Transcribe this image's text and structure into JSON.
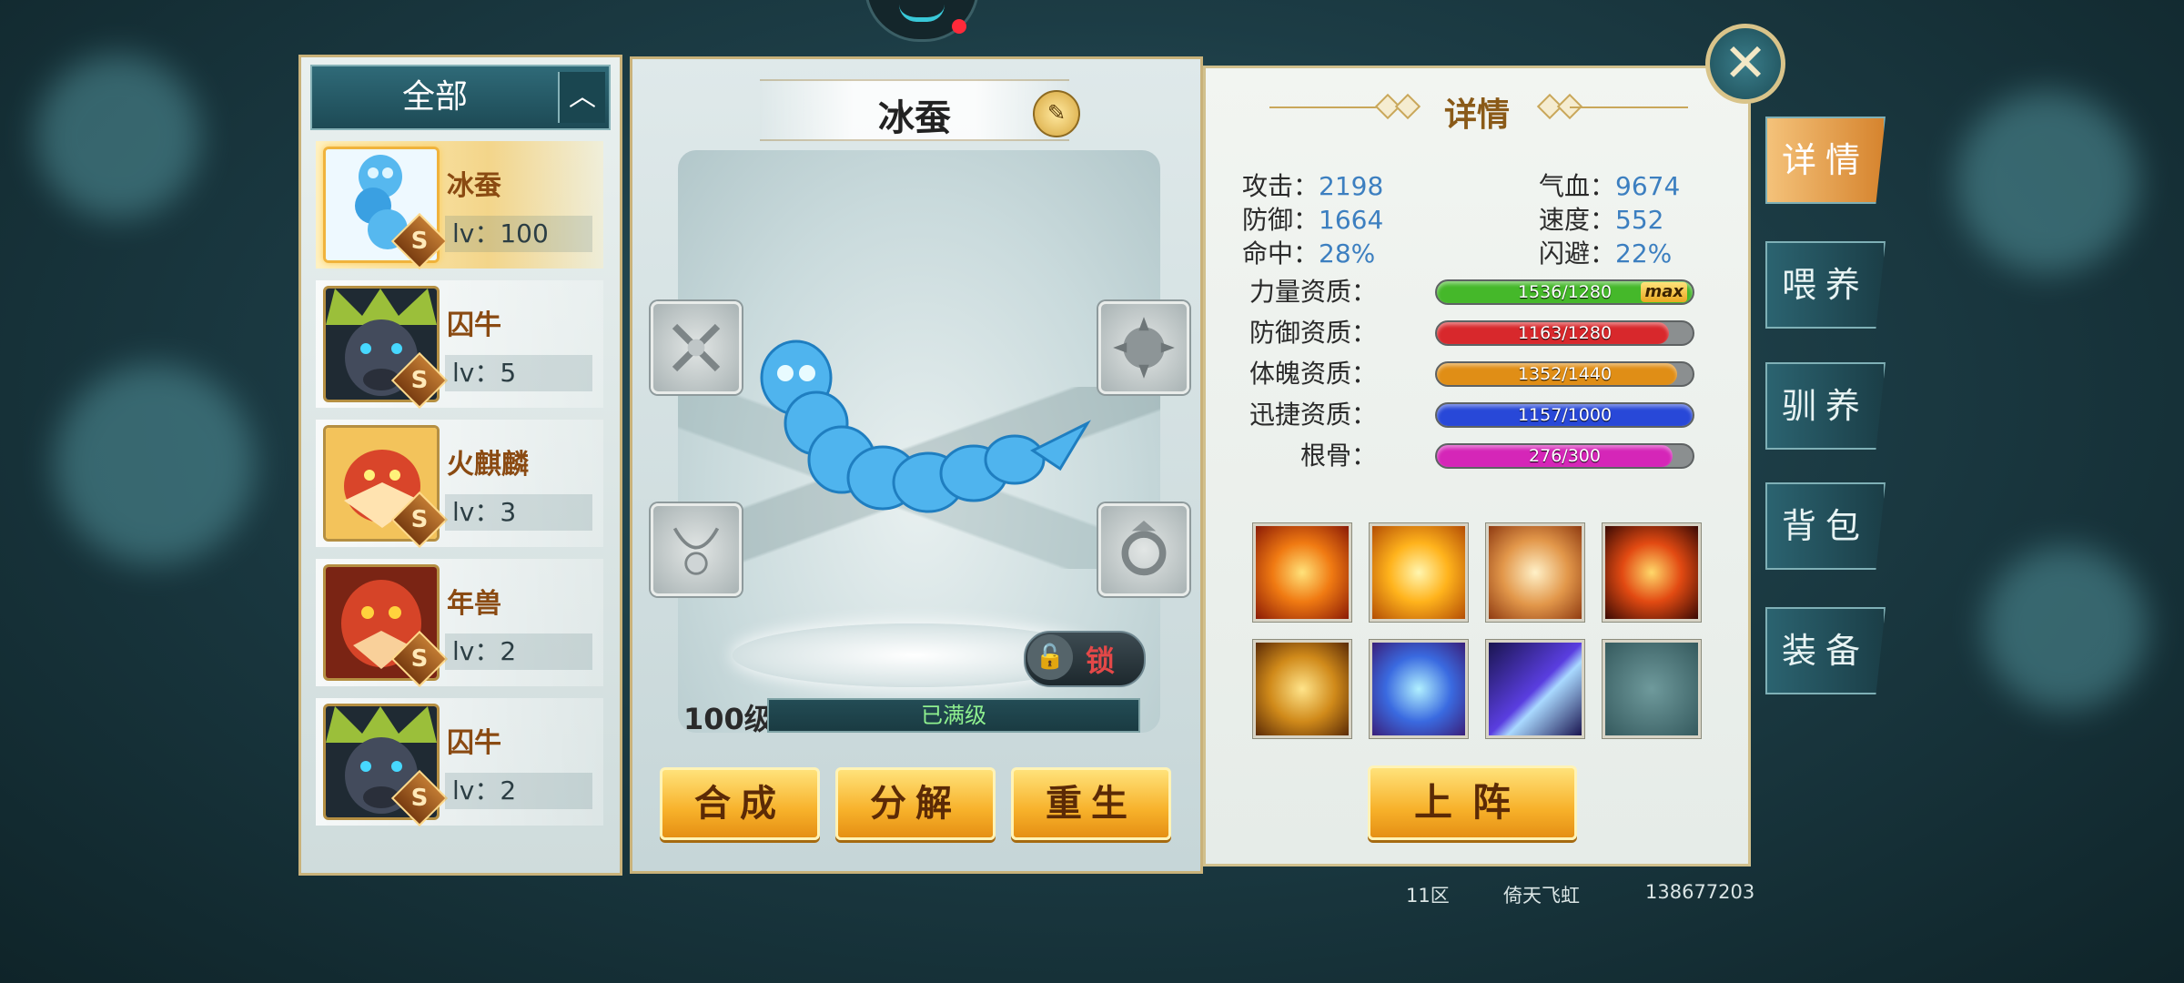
{
  "left_panel": {
    "filter_label": "全部",
    "filter_toggle": "︿",
    "pets": [
      {
        "name": "冰蚕",
        "level": "lv：100",
        "rank": "S"
      },
      {
        "name": "囚牛",
        "level": "lv：5",
        "rank": "S"
      },
      {
        "name": "火麒麟",
        "level": "lv：3",
        "rank": "S"
      },
      {
        "name": "年兽",
        "level": "lv：2",
        "rank": "S"
      },
      {
        "name": "囚牛",
        "level": "lv：2",
        "rank": "S"
      }
    ]
  },
  "center": {
    "pet_name": "冰蚕",
    "lock_label": "锁",
    "level_label": "100级",
    "level_status": "已满级",
    "buttons": {
      "synthesize": "合成",
      "decompose": "分解",
      "rebirth": "重生"
    }
  },
  "detail": {
    "header": "详情",
    "stats": {
      "attack_label": "攻击：",
      "attack": "2198",
      "hp_label": "气血：",
      "hp": "9674",
      "defense_label": "防御：",
      "defense": "1664",
      "speed_label": "速度：",
      "speed": "552",
      "hit_label": "命中：",
      "hit": "28%",
      "dodge_label": "闪避：",
      "dodge": "22%"
    },
    "aptitudes": [
      {
        "label": "力量资质：",
        "value": "1536/1280",
        "fill": 1.0,
        "color": "#45b82a",
        "max": "max"
      },
      {
        "label": "防御资质：",
        "value": "1163/1280",
        "fill": 0.909,
        "color": "#d8282c"
      },
      {
        "label": "体魄资质：",
        "value": "1352/1440",
        "fill": 0.939,
        "color": "#e08e16"
      },
      {
        "label": "迅捷资质：",
        "value": "1157/1000",
        "fill": 1.0,
        "color": "#2848d8"
      },
      {
        "label": "根骨：",
        "value": "276/300",
        "fill": 0.92,
        "color": "#d526b8"
      }
    ],
    "skills": [
      {
        "name": "flame-burst-skill-icon"
      },
      {
        "name": "golden-blast-skill-icon"
      },
      {
        "name": "fire-beast-skill-icon"
      },
      {
        "name": "phoenix-skill-icon"
      },
      {
        "name": "lion-roar-skill-icon"
      },
      {
        "name": "shield-skill-icon"
      },
      {
        "name": "claw-slash-skill-icon"
      },
      {
        "name": "empty-skill-slot-icon"
      }
    ],
    "deploy_label": "上阵"
  },
  "tabs": [
    "详情",
    "喂养",
    "驯养",
    "背包",
    "装备"
  ],
  "close_label": "✕",
  "footer": {
    "server": "11区",
    "player": "倚天飞虹",
    "id": "138677203"
  },
  "colors": {
    "accent_gold": "#f7b12a",
    "panel_teal": "#1d4a55",
    "stat_blue": "#3c7fc0"
  }
}
